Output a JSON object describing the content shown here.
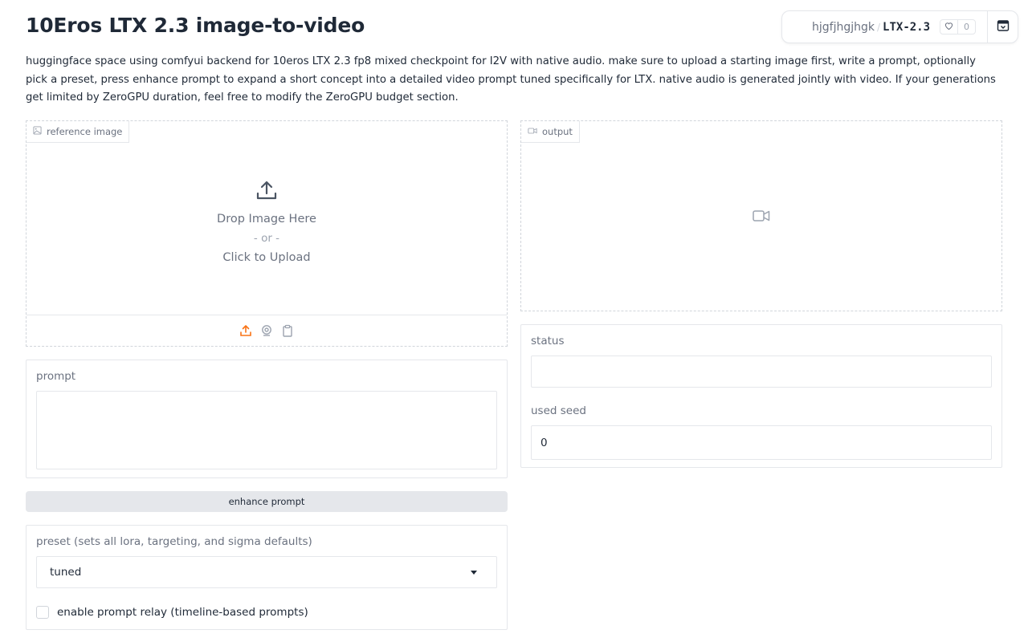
{
  "title": "10Eros LTX 2.3 image-to-video",
  "space_badge": {
    "owner": "hjgfjhgjhgk",
    "separator": "/",
    "repo": "LTX-2.3",
    "likes": "0"
  },
  "description": "huggingface space using comfyui backend for 10eros LTX 2.3 fp8 mixed checkpoint for I2V with native audio. make sure to upload a starting image first, write a prompt, optionally pick a preset, press enhance prompt to expand a short concept into a detailed video prompt tuned specifically for LTX. native audio is generated jointly with video. If your generations get limited by ZeroGPU duration, feel free to modify the ZeroGPU budget section.",
  "reference_image": {
    "label": "reference image",
    "drop_text": "Drop Image Here",
    "or_text": "- or -",
    "click_text": "Click to Upload",
    "sources": [
      "upload-icon",
      "webcam-icon",
      "clipboard-icon"
    ]
  },
  "output": {
    "label": "output"
  },
  "status": {
    "label": "status",
    "value": ""
  },
  "used_seed": {
    "label": "used seed",
    "value": "0"
  },
  "prompt": {
    "label": "prompt",
    "value": ""
  },
  "enhance_button": {
    "label": "enhance prompt"
  },
  "preset": {
    "label": "preset (sets all lora, targeting, and sigma defaults)",
    "selected": "tuned"
  },
  "prompt_relay": {
    "label": "enable prompt relay (timeline-based prompts)",
    "checked": false
  },
  "colors": {
    "accent": "#f97316",
    "text": "#1f2937",
    "muted": "#6b7280",
    "border": "#e5e7eb",
    "button_bg": "#e5e7eb"
  }
}
